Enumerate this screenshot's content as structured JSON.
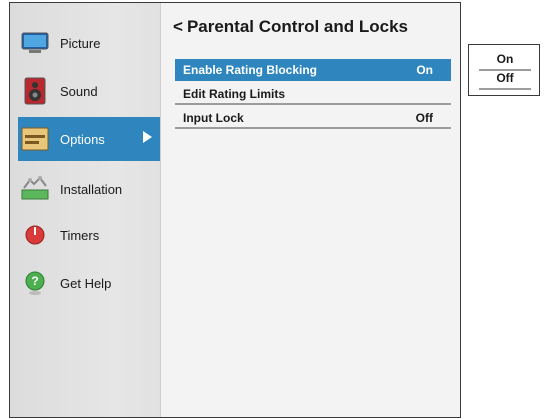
{
  "sidebar": {
    "items": [
      {
        "label": "Picture",
        "icon": "monitor-icon"
      },
      {
        "label": "Sound",
        "icon": "speaker-icon"
      },
      {
        "label": "Options",
        "icon": "options-icon"
      },
      {
        "label": "Installation",
        "icon": "installation-icon"
      },
      {
        "label": "Timers",
        "icon": "timer-icon"
      },
      {
        "label": "Get Help",
        "icon": "help-icon"
      }
    ],
    "active_index": 2
  },
  "content": {
    "back_glyph": "<",
    "title": "Parental Control and Locks",
    "rows": [
      {
        "label": "Enable Rating Blocking",
        "value": "On"
      },
      {
        "label": "Edit Rating Limits",
        "value": ""
      },
      {
        "label": "Input Lock",
        "value": "Off"
      }
    ]
  },
  "popup": {
    "options": [
      "On",
      "Off"
    ]
  },
  "colors": {
    "accent": "#2f86bf",
    "sidebar_bg": "#e2e2e2",
    "content_bg": "#f3f3f3"
  }
}
